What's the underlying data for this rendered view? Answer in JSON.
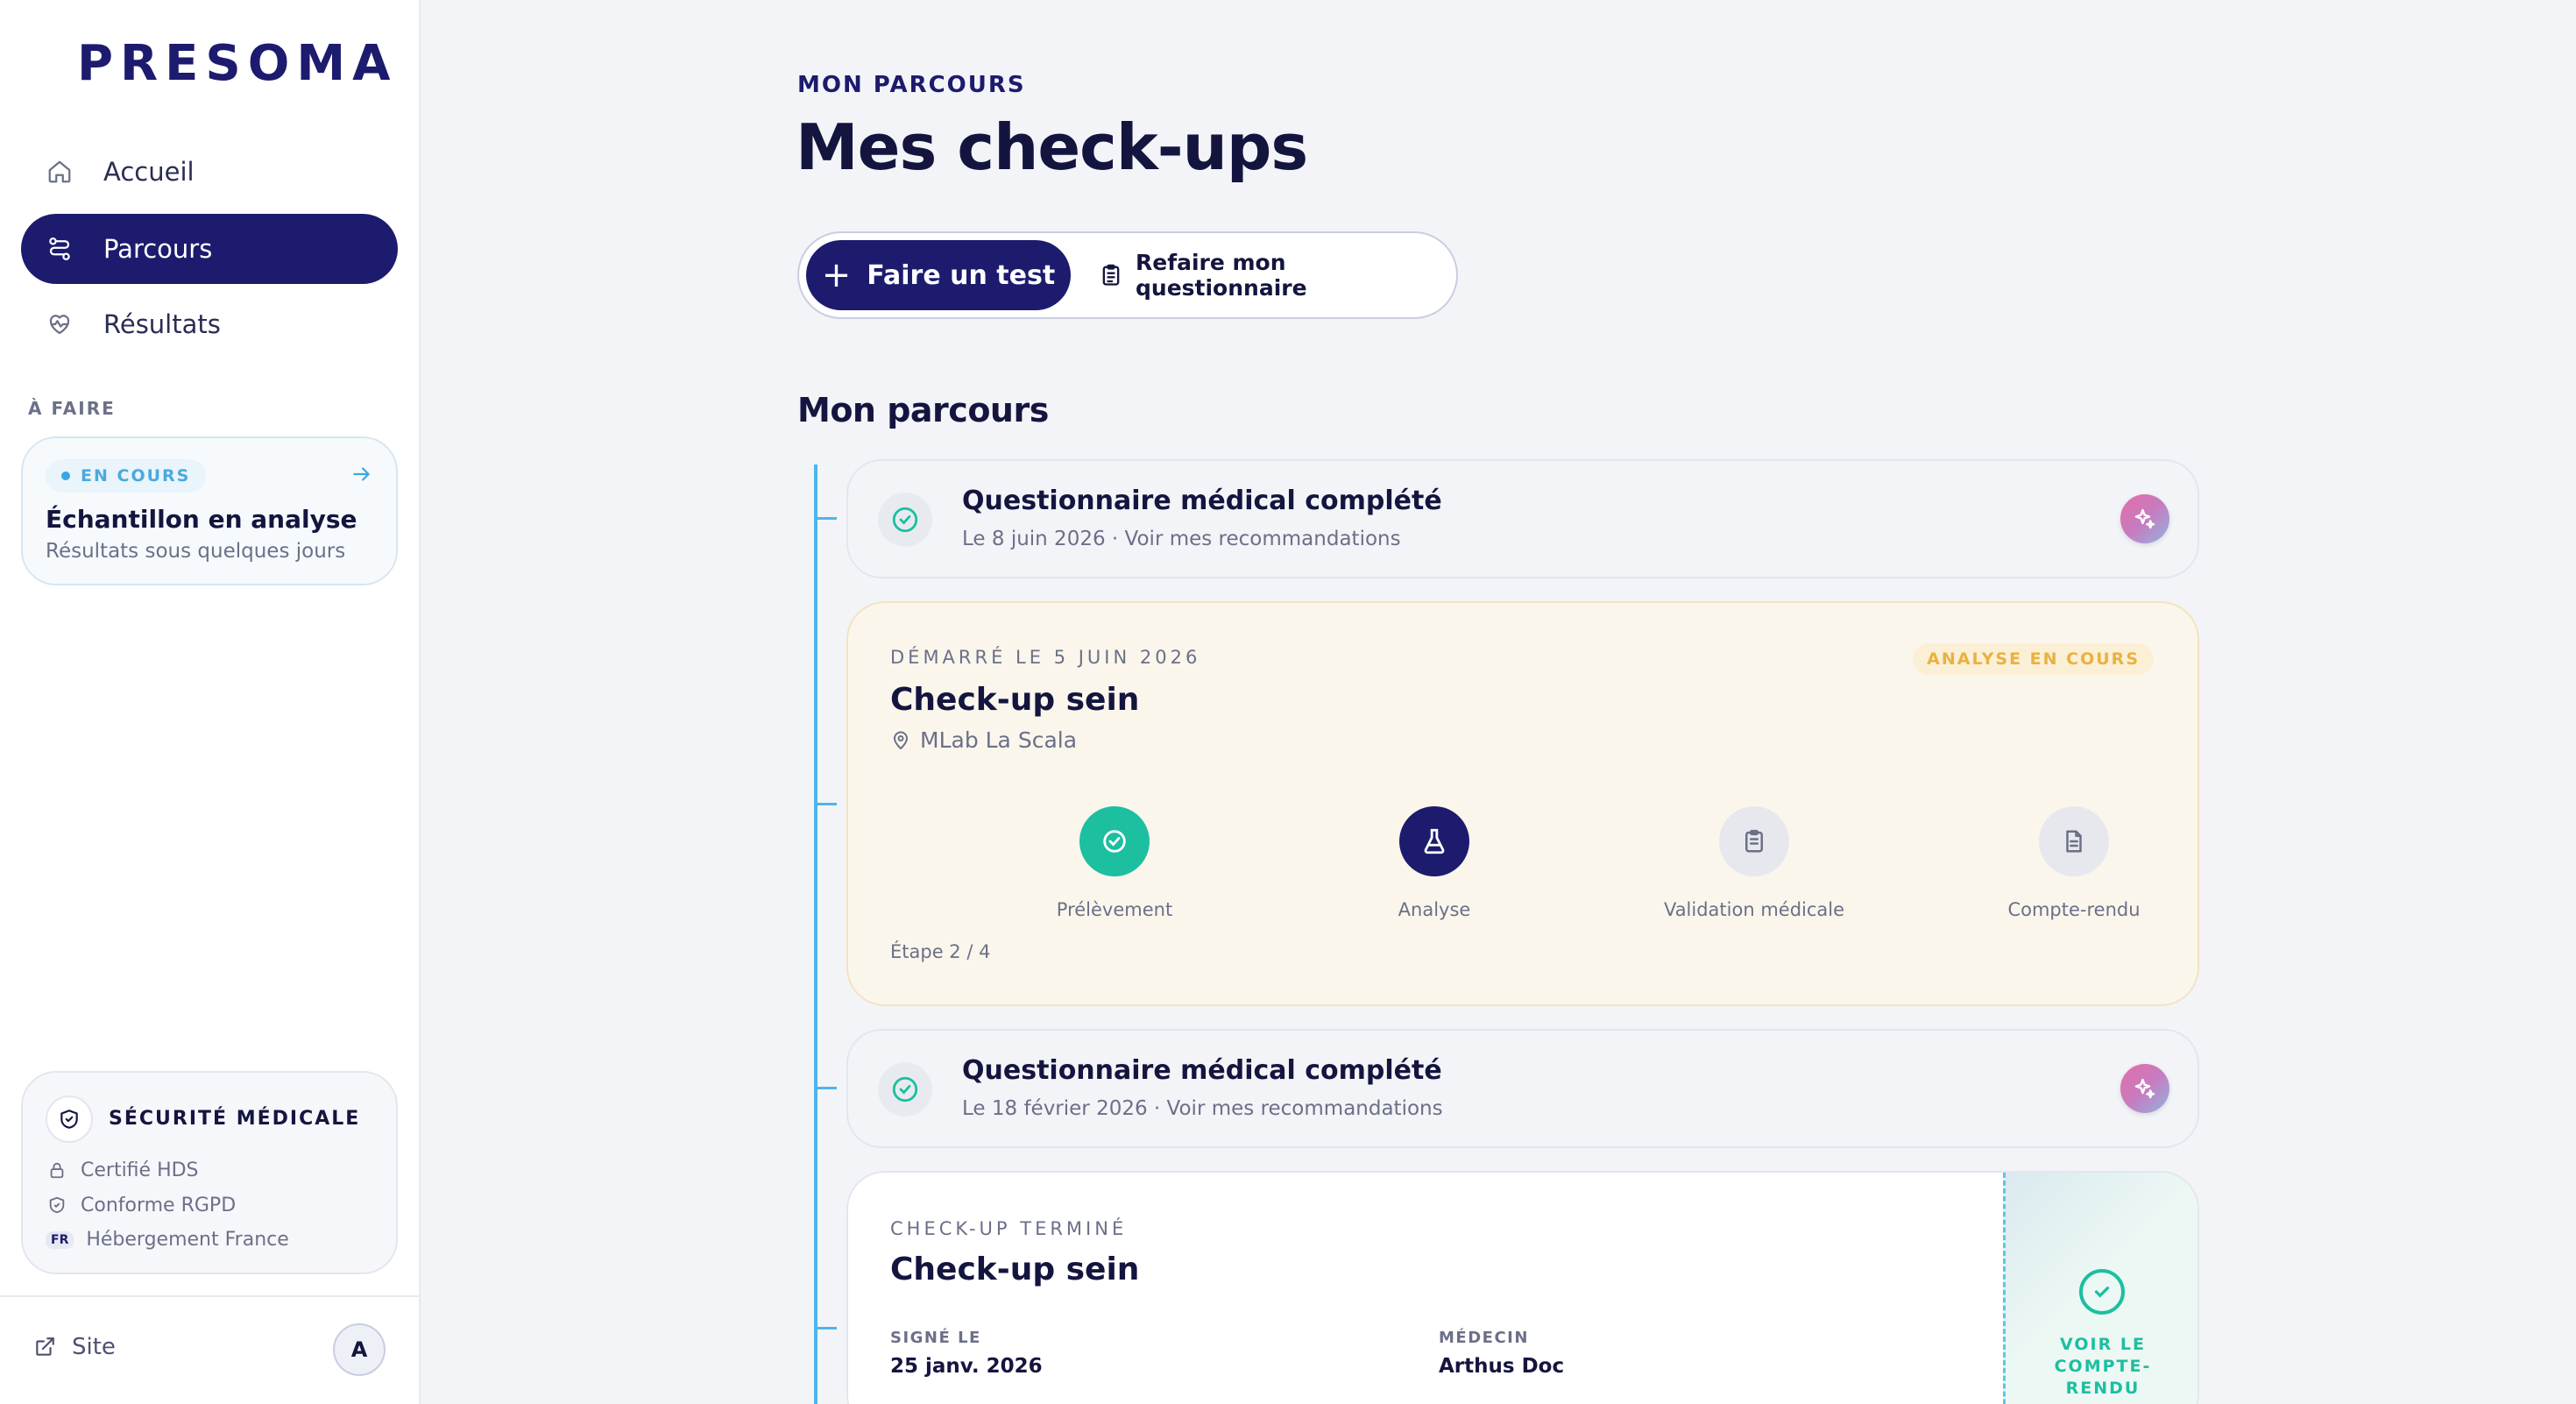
{
  "sidebar": {
    "logo": "PRESOMA",
    "nav": [
      {
        "label": "Accueil",
        "icon": "home-icon"
      },
      {
        "label": "Parcours",
        "icon": "route-icon",
        "active": true
      },
      {
        "label": "Résultats",
        "icon": "heart-pulse-icon"
      }
    ],
    "todo_label": "À FAIRE",
    "todo_card": {
      "badge": "EN COURS",
      "title": "Échantillon en analyse",
      "subtitle": "Résultats sous quelques jours"
    },
    "security": {
      "title": "SÉCURITÉ MÉDICALE",
      "items": [
        {
          "label": "Certifié HDS",
          "icon": "lock-icon"
        },
        {
          "label": "Conforme RGPD",
          "icon": "shield-check-icon"
        },
        {
          "label": "Hébergement France",
          "badge": "FR"
        }
      ]
    },
    "footer": {
      "site_label": "Site",
      "avatar_initial": "A"
    }
  },
  "header": {
    "eyebrow": "MON PARCOURS",
    "title": "Mes check-ups",
    "primary_button": "Faire un test",
    "secondary_button": "Refaire mon questionnaire"
  },
  "timeline": {
    "section_title": "Mon parcours",
    "questionnaire_1": {
      "title": "Questionnaire médical complété",
      "subtitle": "Le 8 juin 2026 · Voir mes recommandations"
    },
    "checkup_active": {
      "started": "DÉMARRÉ LE 5 JUIN 2026",
      "status": "ANALYSE EN COURS",
      "title": "Check-up sein",
      "location": "MLab La Scala",
      "steps": [
        {
          "label": "Prélèvement",
          "state": "done"
        },
        {
          "label": "Analyse",
          "state": "current"
        },
        {
          "label": "Validation médicale",
          "state": "pending"
        },
        {
          "label": "Compte-rendu",
          "state": "pending"
        }
      ],
      "progress": "Étape 2 / 4"
    },
    "questionnaire_2": {
      "title": "Questionnaire médical complété",
      "subtitle": "Le 18 février 2026 · Voir mes recommandations"
    },
    "checkup_done": {
      "eyebrow": "CHECK-UP TERMINÉ",
      "title": "Check-up sein",
      "signed_label": "SIGNÉ LE",
      "signed_value": "25 janv. 2026",
      "doctor_label": "MÉDECIN",
      "doctor_value": "Arthus Doc",
      "cta": "VOIR LE COMPTE-RENDU"
    }
  },
  "colors": {
    "brand": "#1c1b6e",
    "accent_blue": "#4cb6ec",
    "success": "#1cbfa0",
    "warning": "#e9b23f"
  }
}
